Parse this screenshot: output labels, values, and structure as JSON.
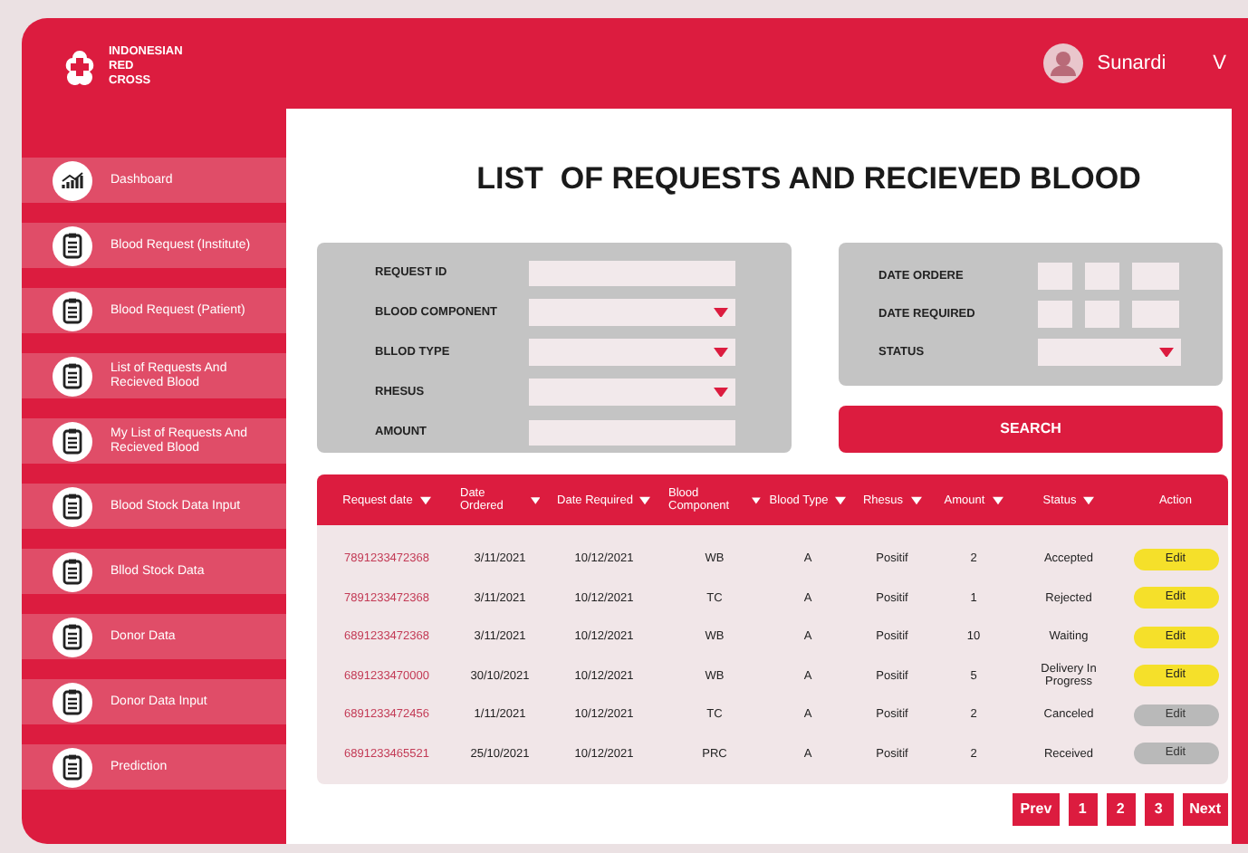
{
  "logo": {
    "lines": [
      "INDONESIAN",
      "RED",
      "CROSS"
    ]
  },
  "user": {
    "name": "Sunardi",
    "menu_icon": "V"
  },
  "sidebar": {
    "items": [
      {
        "label": "Dashboard",
        "kind": "chart"
      },
      {
        "label": "Blood Request (Institute)",
        "kind": "clipboard"
      },
      {
        "label": "Blood Request (Patient)",
        "kind": "clipboard"
      },
      {
        "label": "List of Requests And Recieved Blood",
        "kind": "clipboard"
      },
      {
        "label": "My List of Requests And Recieved Blood",
        "kind": "clipboard"
      },
      {
        "label": "Blood Stock Data Input",
        "kind": "clipboard"
      },
      {
        "label": "Bllod Stock Data",
        "kind": "clipboard"
      },
      {
        "label": "Donor Data",
        "kind": "clipboard"
      },
      {
        "label": "Donor Data Input",
        "kind": "clipboard"
      },
      {
        "label": "Prediction",
        "kind": "clipboard"
      }
    ]
  },
  "title": "LIST  OF REQUESTS AND RECIEVED BLOOD",
  "filters": [
    {
      "label": "REQUEST ID",
      "kind": "text"
    },
    {
      "label": "BLOOD COMPONENT",
      "kind": "select"
    },
    {
      "label": "BLLOD TYPE",
      "kind": "select"
    },
    {
      "label": "RHESUS",
      "kind": "select"
    },
    {
      "label": "AMOUNT",
      "kind": "text"
    }
  ],
  "date_filters": [
    {
      "label": "DATE ORDERE",
      "kind": "date"
    },
    {
      "label": "DATE REQUIRED",
      "kind": "date"
    },
    {
      "label": "STATUS",
      "kind": "select"
    }
  ],
  "search_button": "SEARCH",
  "table": {
    "columns": [
      {
        "label": "Request date",
        "sortable": true
      },
      {
        "label": "Date Ordered",
        "sortable": true
      },
      {
        "label": "Date Required",
        "sortable": true
      },
      {
        "label": "Blood Component",
        "sortable": true
      },
      {
        "label": "Blood Type",
        "sortable": true
      },
      {
        "label": "Rhesus",
        "sortable": true
      },
      {
        "label": "Amount",
        "sortable": true
      },
      {
        "label": "Status",
        "sortable": true
      },
      {
        "label": "Action",
        "sortable": false
      }
    ],
    "rows": [
      {
        "cells": [
          "7891233472368",
          "3/11/2021",
          "10/12/2021",
          "WB",
          "A",
          "Positif",
          "2",
          "Accepted"
        ],
        "action": "Edit",
        "disabled": false
      },
      {
        "cells": [
          "7891233472368",
          "3/11/2021",
          "10/12/2021",
          "TC",
          "A",
          "Positif",
          "1",
          "Rejected"
        ],
        "action": "Edit",
        "disabled": false
      },
      {
        "cells": [
          "6891233472368",
          "3/11/2021",
          "10/12/2021",
          "WB",
          "A",
          "Positif",
          "10",
          "Waiting"
        ],
        "action": "Edit",
        "disabled": false
      },
      {
        "cells": [
          "6891233470000",
          "30/10/2021",
          "10/12/2021",
          "WB",
          "A",
          "Positif",
          "5",
          "Delivery In Progress"
        ],
        "action": "Edit",
        "disabled": false
      },
      {
        "cells": [
          "6891233472456",
          "1/11/2021",
          "10/12/2021",
          "TC",
          "A",
          "Positif",
          "2",
          "Canceled"
        ],
        "action": "Edit",
        "disabled": true
      },
      {
        "cells": [
          "6891233465521",
          "25/10/2021",
          "10/12/2021",
          "PRC",
          "A",
          "Positif",
          "2",
          "Received"
        ],
        "action": "Edit",
        "disabled": true
      }
    ]
  },
  "pagination": [
    "Prev",
    "1",
    "2",
    "3",
    "Next"
  ]
}
